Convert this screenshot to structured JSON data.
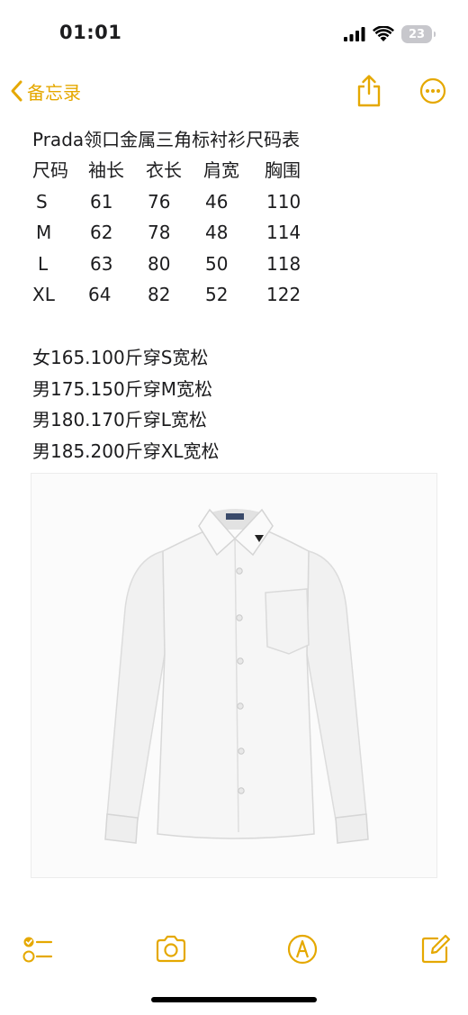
{
  "status_bar": {
    "time": "01:01",
    "battery_level": "23",
    "icons": [
      "cellular-signal-icon",
      "wifi-icon",
      "battery-icon"
    ]
  },
  "nav": {
    "back_label": "备忘录",
    "accent_color": "#e5a800",
    "icons": [
      "chevron-left-icon",
      "share-icon",
      "more-icon"
    ]
  },
  "note": {
    "title": "Prada领口金属三角标衬衫尺码表",
    "table": {
      "headers": [
        "尺码",
        "袖长",
        "衣长",
        "肩宽",
        "胸围"
      ],
      "rows": [
        [
          "S",
          "61",
          "76",
          "46",
          "110"
        ],
        [
          "M",
          "62",
          "78",
          "48",
          "114"
        ],
        [
          "L",
          "63",
          "80",
          "50",
          "118"
        ],
        [
          "XL",
          "64",
          "82",
          "52",
          "122"
        ]
      ]
    },
    "fit_lines": [
      "女165.100斤穿S宽松",
      "男175.150斤穿M宽松",
      "男180.170斤穿L宽松",
      "男185.200斤穿XL宽松"
    ]
  },
  "image": {
    "subject": "white-long-sleeve-shirt"
  },
  "toolbar": {
    "icons": [
      "checklist-icon",
      "camera-icon",
      "markup-pen-icon",
      "compose-icon"
    ]
  }
}
